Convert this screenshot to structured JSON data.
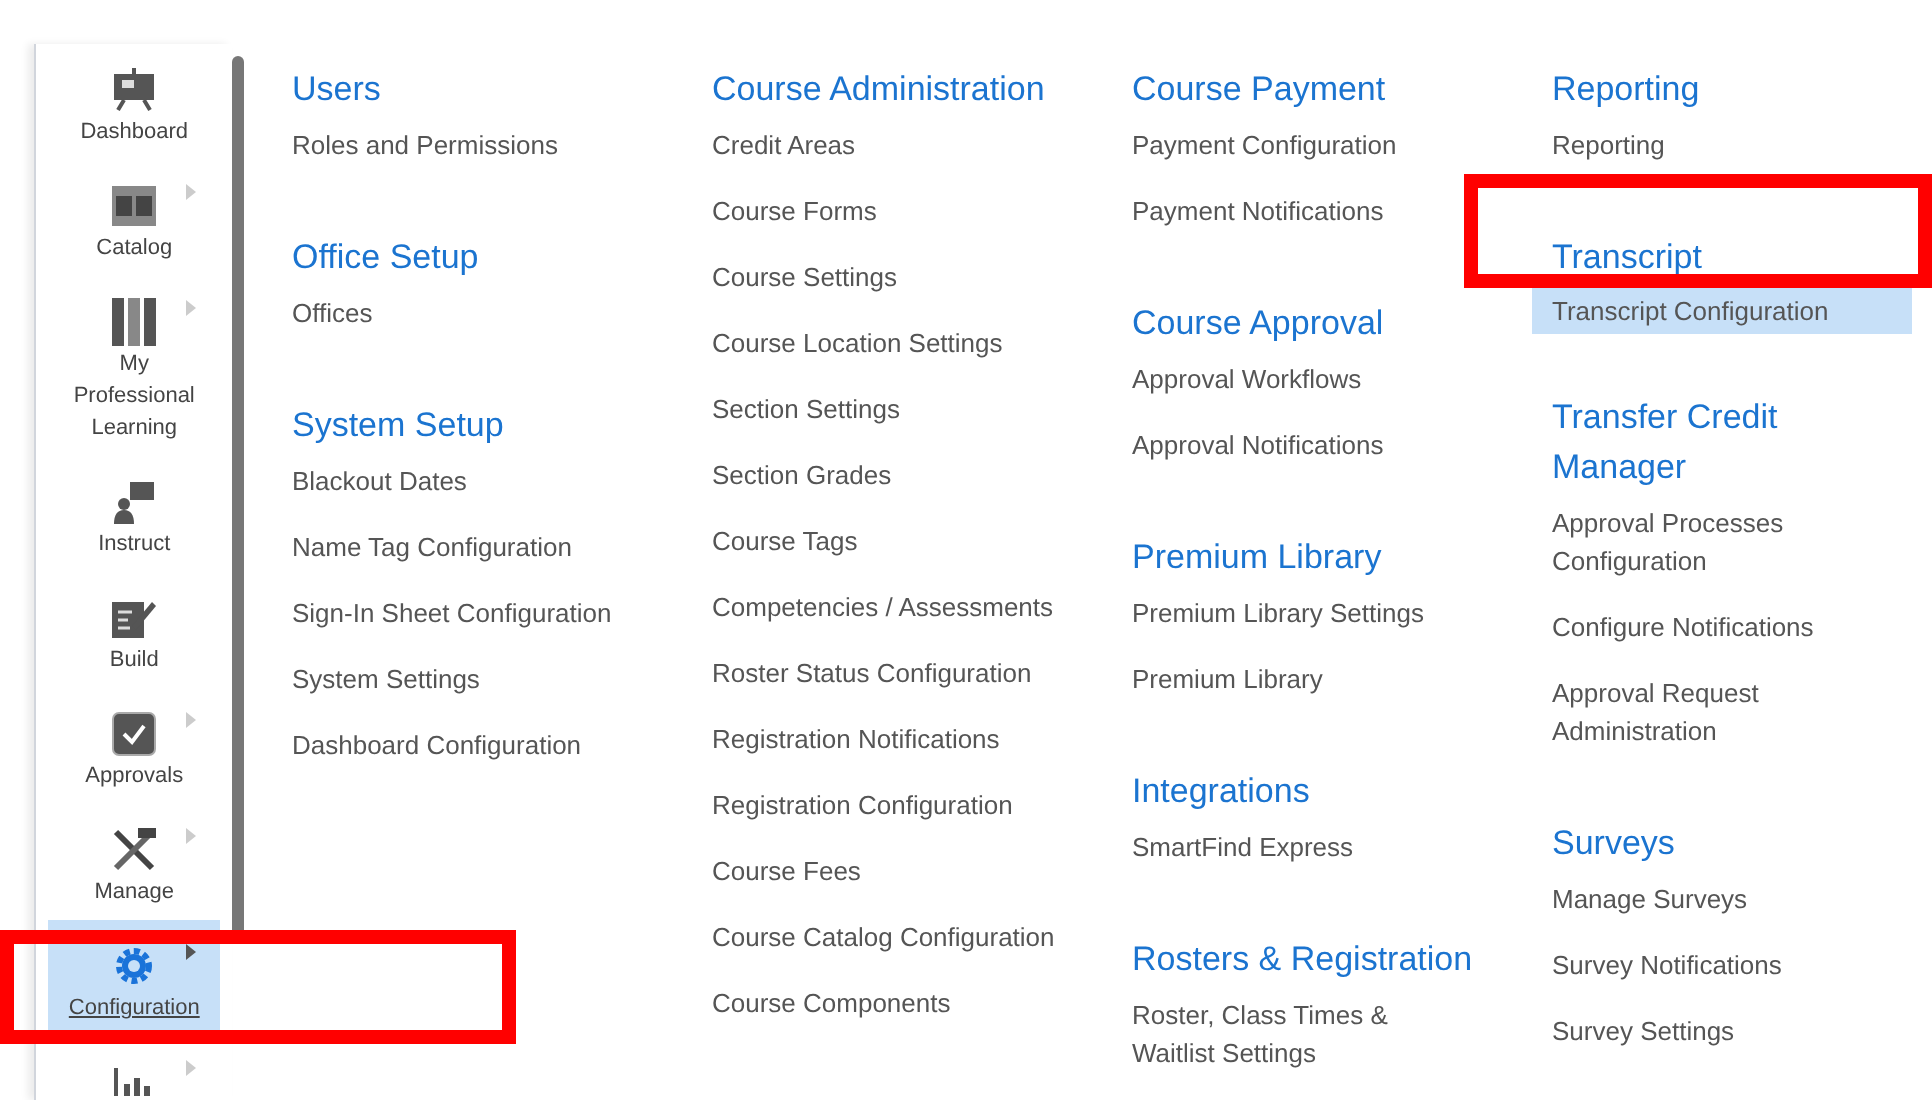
{
  "sidebar": {
    "items": [
      {
        "label": "Dashboard",
        "submenu": false,
        "selected": false
      },
      {
        "label": "Catalog",
        "submenu": true,
        "selected": false
      },
      {
        "label": "My Professional Learning",
        "submenu": true,
        "selected": false
      },
      {
        "label": "Instruct",
        "submenu": false,
        "selected": false
      },
      {
        "label": "Build",
        "submenu": false,
        "selected": false
      },
      {
        "label": "Approvals",
        "submenu": true,
        "selected": false
      },
      {
        "label": "Manage",
        "submenu": true,
        "selected": false
      },
      {
        "label": "Configuration",
        "submenu": true,
        "selected": true
      },
      {
        "submenu": true,
        "selected": false
      }
    ]
  },
  "columns": [
    [
      {
        "title": "Users",
        "links": [
          {
            "label": "Roles and Permissions",
            "selected": false
          }
        ]
      },
      {
        "title": "Office Setup",
        "links": [
          {
            "label": "Offices",
            "selected": false
          }
        ]
      },
      {
        "title": "System Setup",
        "links": [
          {
            "label": "Blackout Dates",
            "selected": false
          },
          {
            "label": "Name Tag Configuration",
            "selected": false
          },
          {
            "label": "Sign-In Sheet Configuration",
            "selected": false
          },
          {
            "label": "System Settings",
            "selected": false
          },
          {
            "label": "Dashboard Configuration",
            "selected": false
          }
        ]
      }
    ],
    [
      {
        "title": "Course Administration",
        "links": [
          {
            "label": "Credit Areas",
            "selected": false
          },
          {
            "label": "Course Forms",
            "selected": false
          },
          {
            "label": "Course Settings",
            "selected": false
          },
          {
            "label": "Course Location Settings",
            "selected": false
          },
          {
            "label": "Section Settings",
            "selected": false
          },
          {
            "label": "Section Grades",
            "selected": false
          },
          {
            "label": "Course Tags",
            "selected": false
          },
          {
            "label": "Competencies / Assessments",
            "selected": false
          },
          {
            "label": "Roster Status Configuration",
            "selected": false
          },
          {
            "label": "Registration Notifications",
            "selected": false
          },
          {
            "label": "Registration Configuration",
            "selected": false
          },
          {
            "label": "Course Fees",
            "selected": false
          },
          {
            "label": "Course Catalog Configuration",
            "selected": false
          },
          {
            "label": "Course Components",
            "selected": false
          }
        ]
      }
    ],
    [
      {
        "title": "Course Payment",
        "links": [
          {
            "label": "Payment Configuration",
            "selected": false
          },
          {
            "label": "Payment Notifications",
            "selected": false
          }
        ]
      },
      {
        "title": "Course Approval",
        "links": [
          {
            "label": "Approval Workflows",
            "selected": false
          },
          {
            "label": "Approval Notifications",
            "selected": false
          }
        ]
      },
      {
        "title": "Premium Library",
        "links": [
          {
            "label": "Premium Library Settings",
            "selected": false
          },
          {
            "label": "Premium Library",
            "selected": false
          }
        ]
      },
      {
        "title": "Integrations",
        "links": [
          {
            "label": "SmartFind Express",
            "selected": false
          }
        ]
      },
      {
        "title": "Rosters & Registration",
        "links": [
          {
            "label": "Roster, Class Times & Waitlist Settings",
            "selected": false
          }
        ]
      }
    ],
    [
      {
        "title": "Reporting",
        "links": [
          {
            "label": "Reporting",
            "selected": false
          }
        ]
      },
      {
        "title": "Transcript",
        "links": [
          {
            "label": "Transcript Configuration",
            "selected": true
          }
        ]
      },
      {
        "title": "Transfer Credit Manager",
        "links": [
          {
            "label": "Approval Processes Configuration",
            "selected": false
          },
          {
            "label": "Configure Notifications",
            "selected": false
          },
          {
            "label": "Approval Request Administration",
            "selected": false
          }
        ]
      },
      {
        "title": "Surveys",
        "links": [
          {
            "label": "Manage Surveys",
            "selected": false
          },
          {
            "label": "Survey Notifications",
            "selected": false
          },
          {
            "label": "Survey Settings",
            "selected": false
          }
        ]
      }
    ]
  ]
}
